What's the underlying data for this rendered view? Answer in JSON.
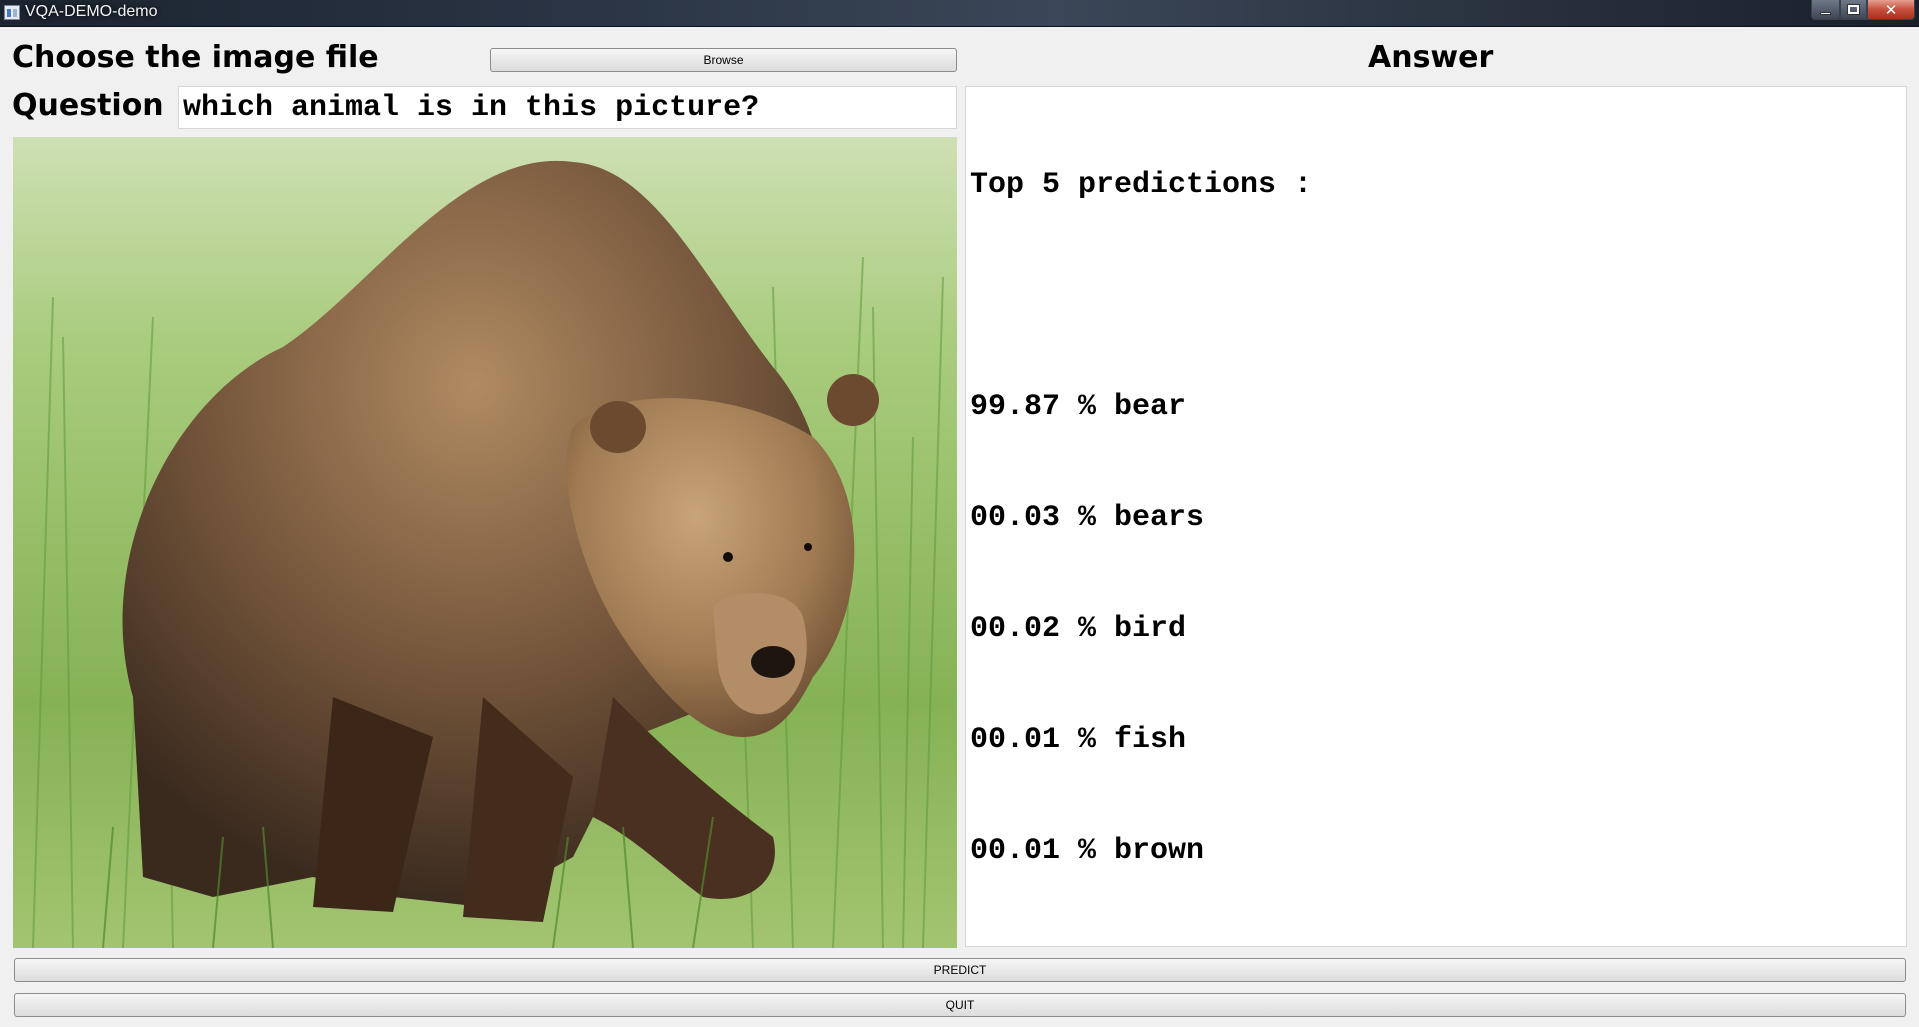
{
  "window": {
    "title": "VQA-DEMO-demo",
    "icon": "app-window-icon",
    "controls": {
      "minimize_icon": "minimize-icon",
      "maximize_icon": "maximize-icon",
      "close_label": "✕"
    }
  },
  "image_section": {
    "label": "Choose the image file",
    "browse_label": "Browse",
    "image_description": "brown-bear-photo"
  },
  "question": {
    "label": "Question",
    "value": "which animal is in this picture?"
  },
  "answer": {
    "label": "Answer",
    "heading": "Top 5 predictions :",
    "predictions": [
      {
        "text": "99.87 % bear"
      },
      {
        "text": "00.03 % bears"
      },
      {
        "text": "00.02 % bird"
      },
      {
        "text": "00.01 % fish"
      },
      {
        "text": "00.01 % brown"
      }
    ]
  },
  "actions": {
    "predict_label": "PREDICT",
    "quit_label": "QUIT"
  }
}
